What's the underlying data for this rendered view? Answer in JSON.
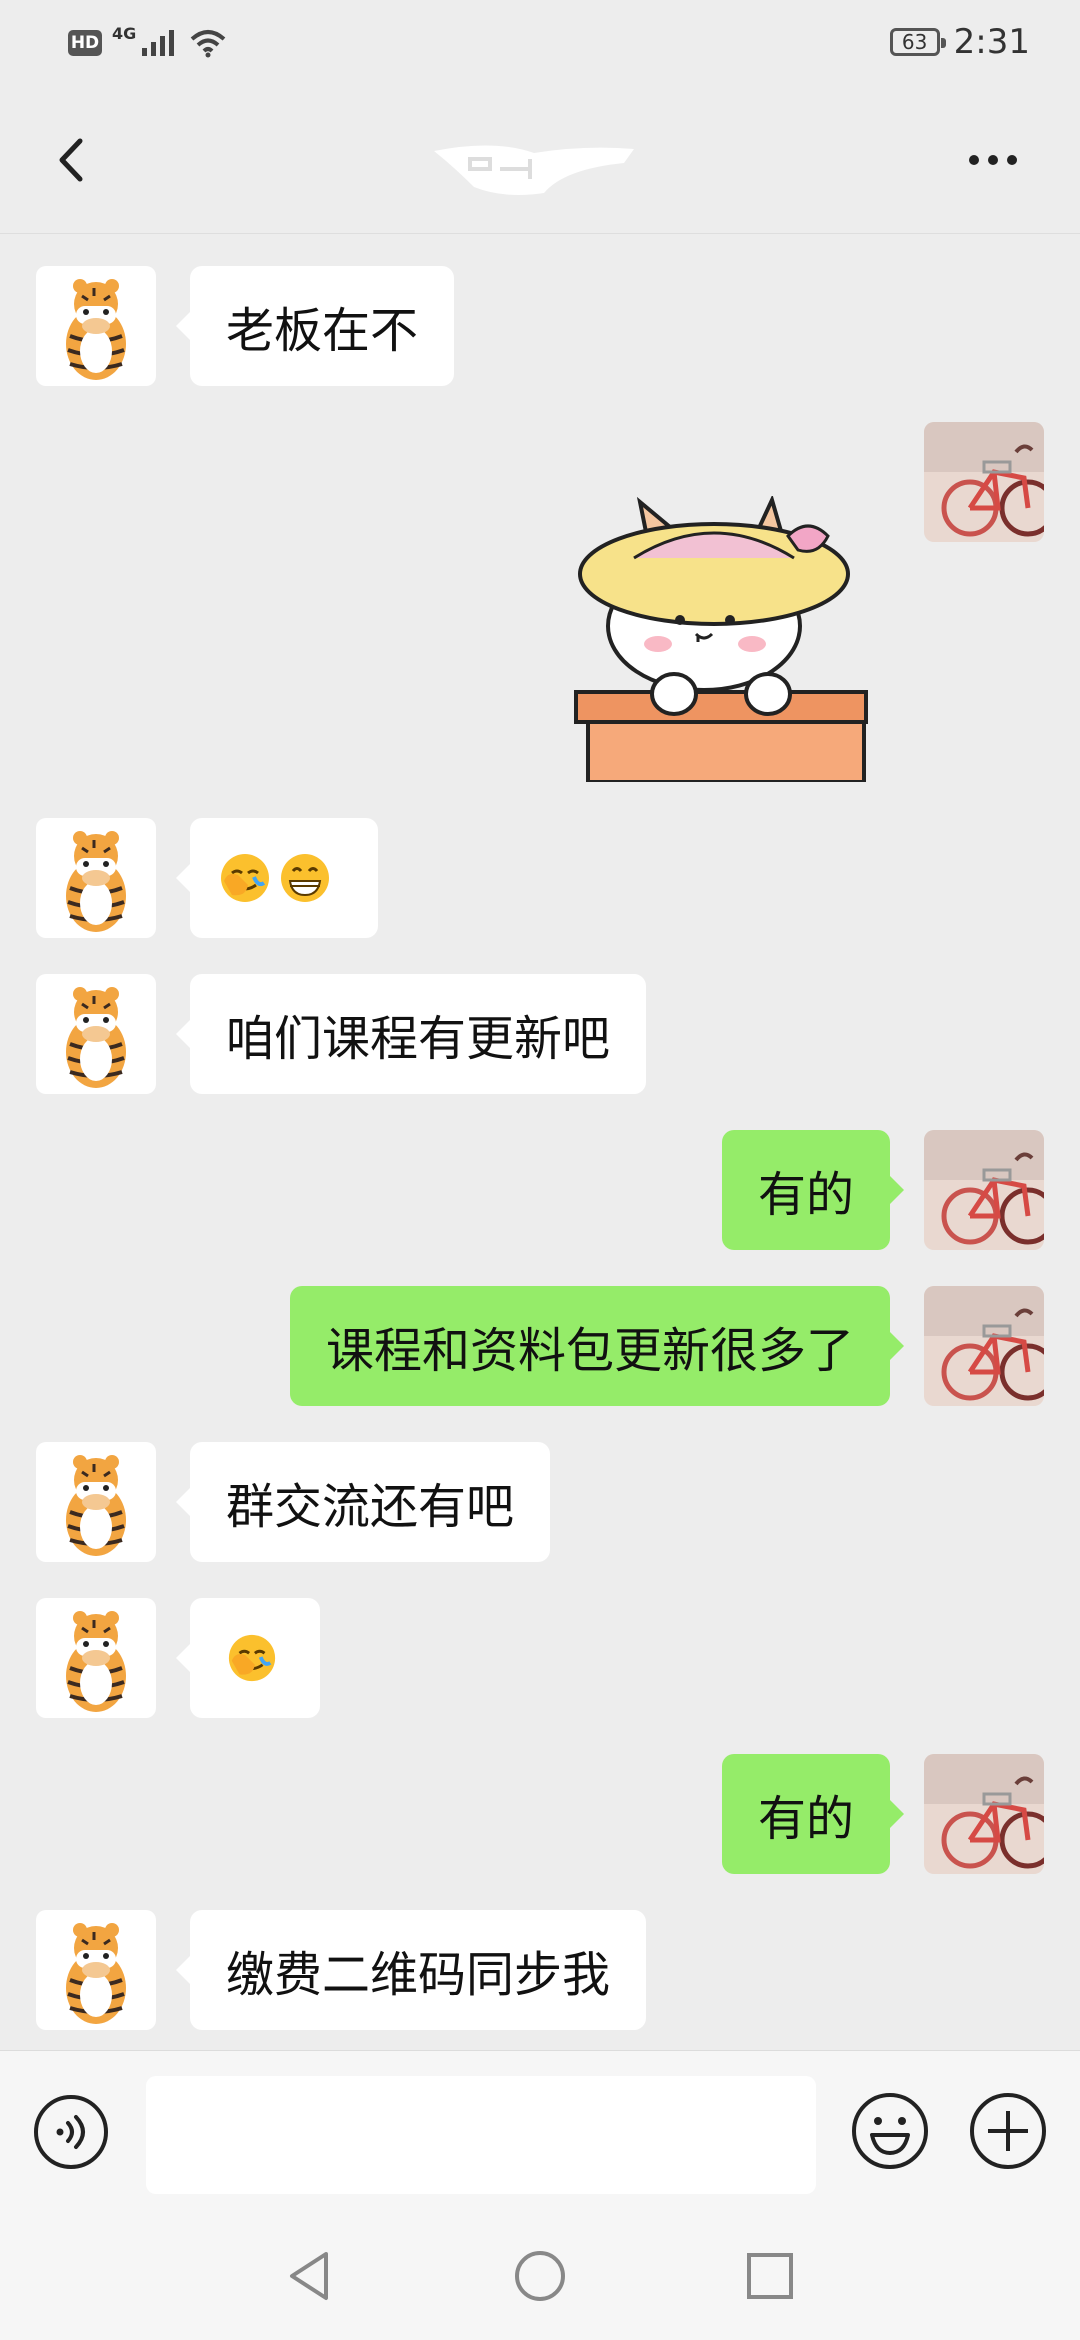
{
  "status_bar": {
    "hd": "HD",
    "network": "4G",
    "battery": "63",
    "time": "2:31"
  },
  "header": {
    "back_icon": "chevron-left-icon",
    "more_icon": "more-horizontal-icon"
  },
  "messages": [
    {
      "from": "contact",
      "text": "老板在不"
    },
    {
      "from": "me",
      "sticker": "cat-with-hat-sticker"
    },
    {
      "from": "contact",
      "emojis": [
        "face-palm-emoji",
        "grinning-emoji"
      ]
    },
    {
      "from": "contact",
      "text": "咱们课程有更新吧"
    },
    {
      "from": "me",
      "text": "有的"
    },
    {
      "from": "me",
      "text": "课程和资料包更新很多了"
    },
    {
      "from": "contact",
      "text": "群交流还有吧"
    },
    {
      "from": "contact",
      "emojis": [
        "face-palm-emoji"
      ]
    },
    {
      "from": "me",
      "text": "有的"
    },
    {
      "from": "contact",
      "text": "缴费二维码同步我"
    }
  ],
  "input": {
    "value": "",
    "voice_icon": "voice-icon",
    "emoji_icon": "smile-icon",
    "add_icon": "plus-icon"
  },
  "system_nav": {
    "back": "triangle-back-icon",
    "home": "circle-home-icon",
    "recents": "square-recents-icon"
  },
  "colors": {
    "background": "#ededed",
    "outgoing_bubble": "#95ec69",
    "incoming_bubble": "#ffffff"
  }
}
